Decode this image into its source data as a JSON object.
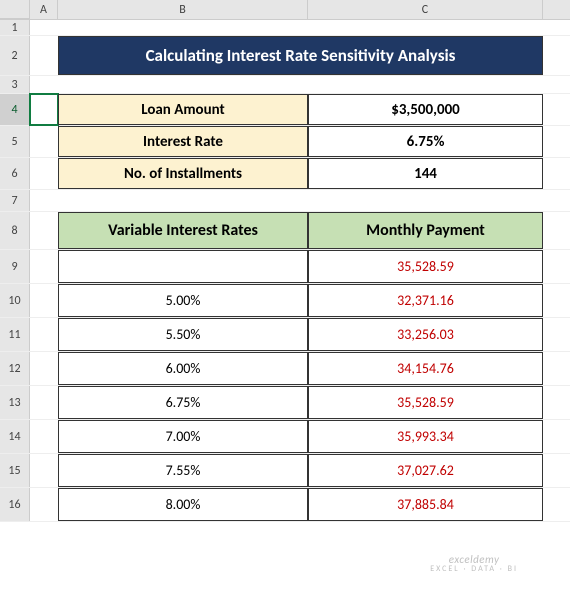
{
  "columns": {
    "A": "A",
    "B": "B",
    "C": "C"
  },
  "rows": [
    "1",
    "2",
    "3",
    "4",
    "5",
    "6",
    "7",
    "8",
    "9",
    "10",
    "11",
    "12",
    "13",
    "14",
    "15",
    "16"
  ],
  "title": "Calculating Interest Rate Sensitivity Analysis",
  "inputs": {
    "loan_label": "Loan Amount",
    "loan_value": "$3,500,000",
    "rate_label": "Interest Rate",
    "rate_value": "6.75%",
    "inst_label": "No. of Installments",
    "inst_value": "144"
  },
  "table_header": {
    "rates": "Variable Interest Rates",
    "payment": "Monthly Payment"
  },
  "table": [
    {
      "rate": "",
      "payment": "35,528.59"
    },
    {
      "rate": "5.00%",
      "payment": "32,371.16"
    },
    {
      "rate": "5.50%",
      "payment": "33,256.03"
    },
    {
      "rate": "6.00%",
      "payment": "34,154.76"
    },
    {
      "rate": "6.75%",
      "payment": "35,528.59"
    },
    {
      "rate": "7.00%",
      "payment": "35,993.34"
    },
    {
      "rate": "7.55%",
      "payment": "37,027.62"
    },
    {
      "rate": "8.00%",
      "payment": "37,885.84"
    }
  ],
  "watermark": {
    "main": "exceldemy",
    "sub": "EXCEL · DATA · BI"
  },
  "chart_data": {
    "type": "table",
    "title": "Calculating Interest Rate Sensitivity Analysis",
    "parameters": {
      "loan_amount": 3500000,
      "interest_rate": 0.0675,
      "installments": 144
    },
    "columns": [
      "Variable Interest Rates",
      "Monthly Payment"
    ],
    "rows": [
      {
        "rate": null,
        "payment": 35528.59
      },
      {
        "rate": 0.05,
        "payment": 32371.16
      },
      {
        "rate": 0.055,
        "payment": 33256.03
      },
      {
        "rate": 0.06,
        "payment": 34154.76
      },
      {
        "rate": 0.0675,
        "payment": 35528.59
      },
      {
        "rate": 0.07,
        "payment": 35993.34
      },
      {
        "rate": 0.0755,
        "payment": 37027.62
      },
      {
        "rate": 0.08,
        "payment": 37885.84
      }
    ]
  }
}
